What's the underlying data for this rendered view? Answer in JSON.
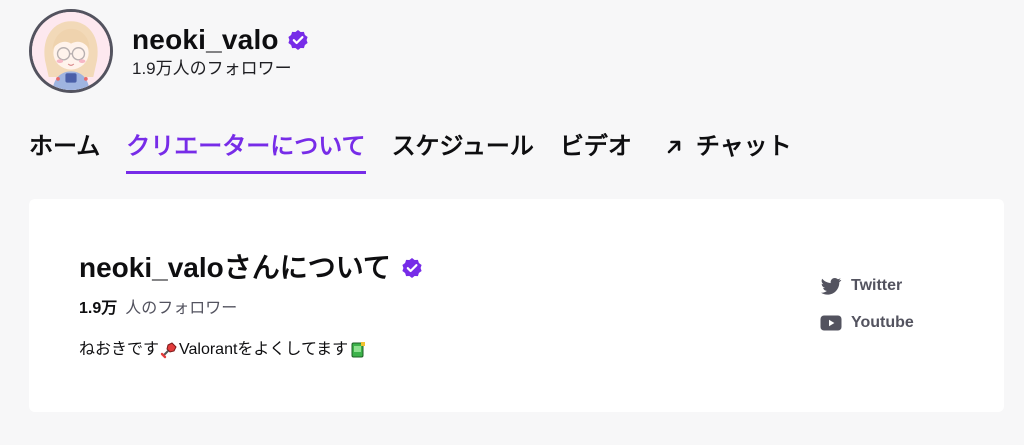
{
  "channel": {
    "name": "neoki_valo",
    "followers_line": "1.9万人のフォロワー"
  },
  "tabs": [
    {
      "label": "ホーム",
      "active": false
    },
    {
      "label": "クリエーターについて",
      "active": true
    },
    {
      "label": "スケジュール",
      "active": false
    },
    {
      "label": "ビデオ",
      "active": false
    },
    {
      "label": "チャット",
      "active": false
    }
  ],
  "about": {
    "title": "neoki_valoさんについて",
    "follower_count": "1.9万",
    "follower_label": "人のフォロワー",
    "bio_part1": "ねおきです",
    "bio_part2": "Valorantをよくしてます"
  },
  "social_links": [
    {
      "label": "Twitter",
      "icon": "twitter-icon"
    },
    {
      "label": "Youtube",
      "icon": "youtube-icon"
    }
  ],
  "colors": {
    "accent": "#772ce8",
    "verified": "#772ce8",
    "background": "#f7f7f8",
    "card": "#ffffff",
    "muted_text": "#53535f"
  }
}
